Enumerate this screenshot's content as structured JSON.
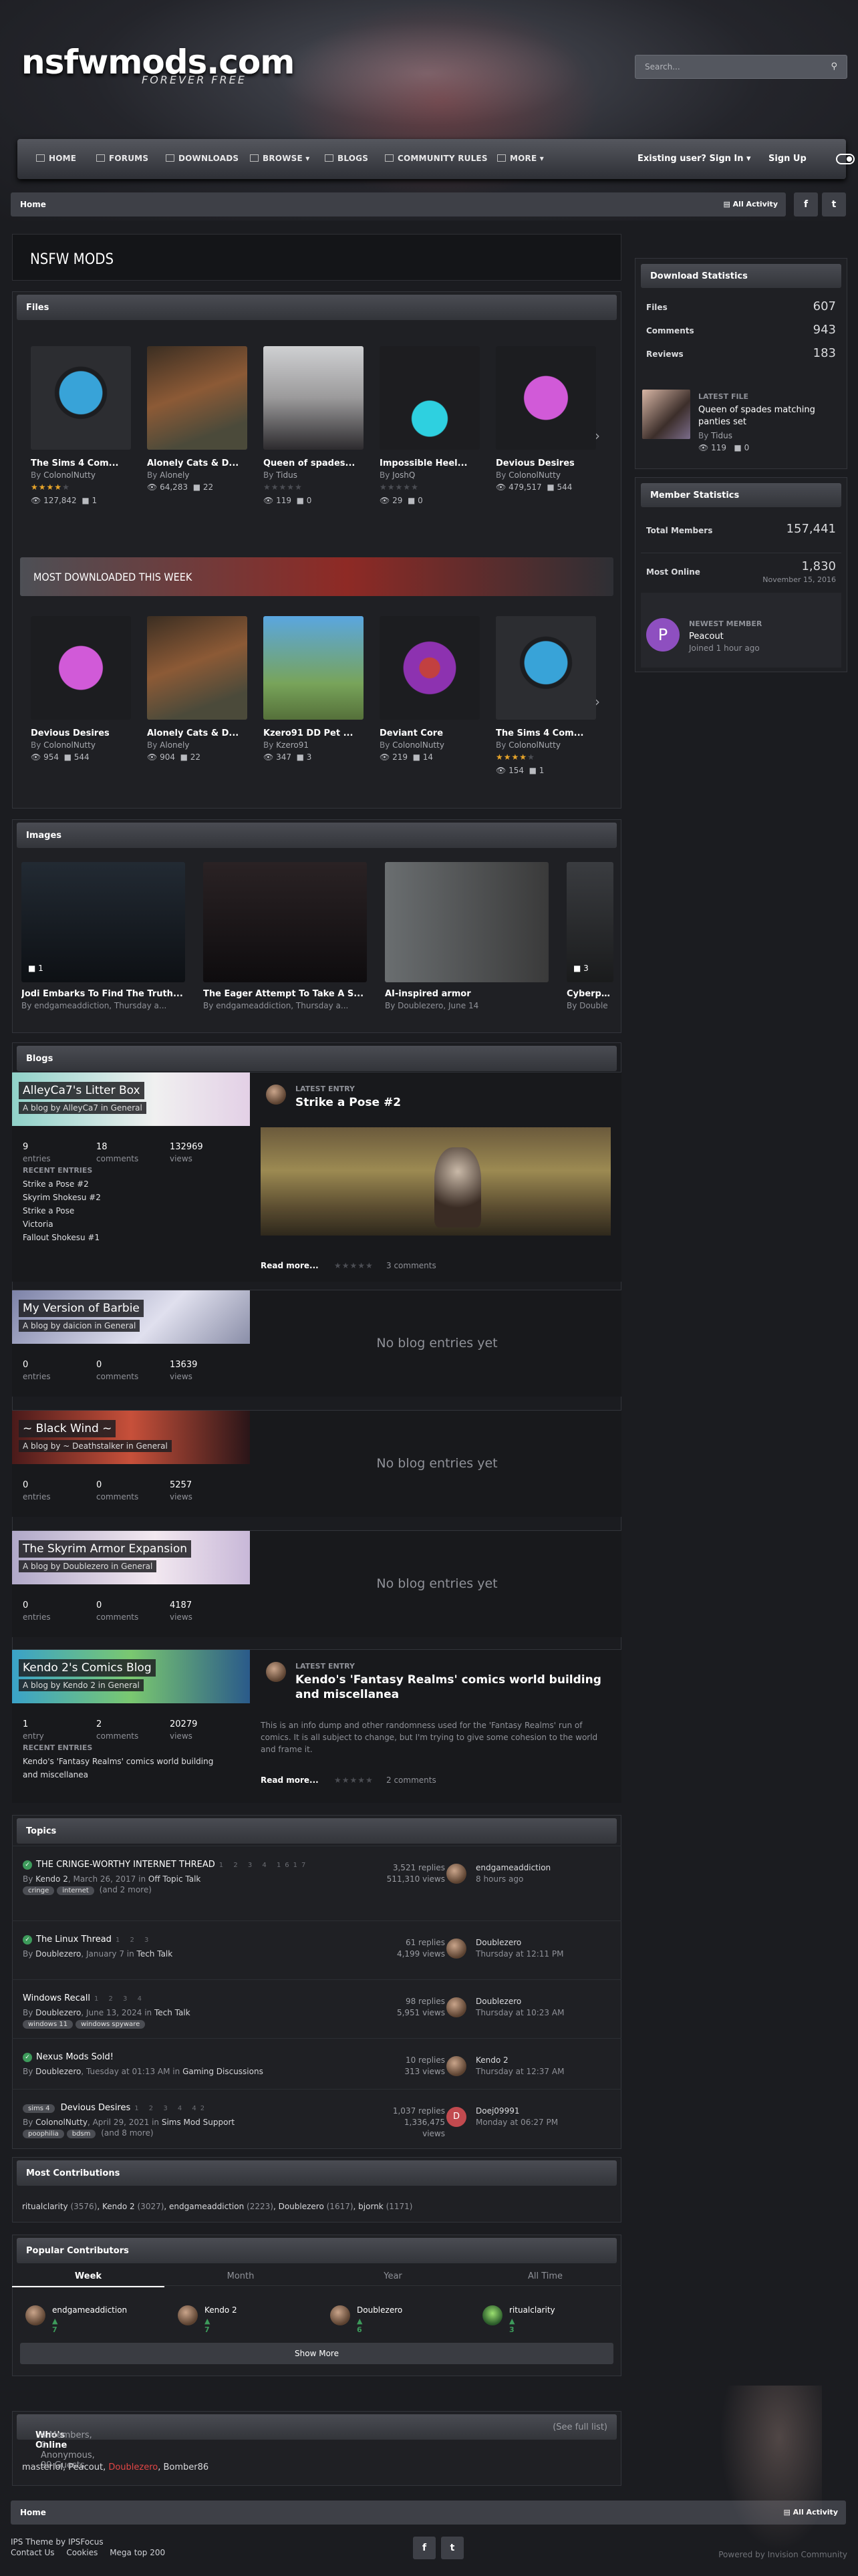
{
  "site": {
    "logo": "nsfwmods.com",
    "tagline": "FOREVER FREE"
  },
  "search": {
    "placeholder": "Search..."
  },
  "nav": {
    "items": [
      "Home",
      "Forums",
      "Downloads",
      "Browse",
      "Blogs",
      "Community Rules",
      "More"
    ],
    "sign_in": "Existing user? Sign In",
    "sign_up": "Sign Up"
  },
  "breadcrumb": {
    "home": "Home",
    "all_activity": "All Activity"
  },
  "page_title": "NSFW MODS",
  "files": {
    "title": "Files",
    "cards": [
      {
        "title": "The Sims 4 Com...",
        "by": "By",
        "author": "ColonolNutty",
        "views": "127,842",
        "comments": "1",
        "rating": 4
      },
      {
        "title": "Alonely Cats & D...",
        "by": "By",
        "author": "Alonely",
        "views": "64,283",
        "comments": "22",
        "rating": -1
      },
      {
        "title": "Queen of spades...",
        "by": "By",
        "author": "Tidus",
        "views": "119",
        "comments": "0",
        "rating": 0
      },
      {
        "title": "Impossible Heel...",
        "by": "By",
        "author": "JoshQ",
        "views": "29",
        "comments": "0",
        "rating": 0
      },
      {
        "title": "Devious Desires",
        "by": "By",
        "author": "ColonolNutty",
        "views": "479,517",
        "comments": "544",
        "rating": -1
      }
    ]
  },
  "most_downloaded": {
    "title": "MOST DOWNLOADED THIS WEEK",
    "cards": [
      {
        "title": "Devious Desires",
        "by": "By",
        "author": "ColonolNutty",
        "views": "954",
        "comments": "544",
        "rating": -1
      },
      {
        "title": "Alonely Cats & D...",
        "by": "By",
        "author": "Alonely",
        "views": "904",
        "comments": "22",
        "rating": -1
      },
      {
        "title": "Kzero91 DD Pet ...",
        "by": "By",
        "author": "Kzero91",
        "views": "347",
        "comments": "3",
        "rating": -1
      },
      {
        "title": "Deviant Core",
        "by": "By",
        "author": "ColonolNutty",
        "views": "219",
        "comments": "14",
        "rating": -1
      },
      {
        "title": "The Sims 4 Com...",
        "by": "By",
        "author": "ColonolNutty",
        "views": "154",
        "comments": "1",
        "rating": 4
      }
    ]
  },
  "images": {
    "title": "Images",
    "cards": [
      {
        "title": "Jodi Embarks To Find The Truth...",
        "meta": "By endgameaddiction, Thursday a...",
        "comments": "1"
      },
      {
        "title": "The Eager Attempt To Take A S...",
        "meta": "By endgameaddiction, Thursday a...",
        "comments": ""
      },
      {
        "title": "AI-inspired armor",
        "meta": "By Doublezero, June 14",
        "comments": ""
      },
      {
        "title": "Cyberpun",
        "meta": "By Double",
        "comments": "3"
      }
    ]
  },
  "blogs": {
    "title": "Blogs",
    "labels": {
      "entries": "entries",
      "entry": "entry",
      "comments": "comments",
      "views": "views",
      "recent": "RECENT ENTRIES",
      "latest": "LATEST ENTRY",
      "read_more": "Read more...",
      "no_entries": "No blog entries yet"
    },
    "items": [
      {
        "name": "AlleyCa7's Litter Box",
        "by": "A blog by AlleyCa7 in General",
        "entries": "9",
        "comments": "18",
        "views": "132969",
        "recent": [
          "Strike a Pose #2",
          "Skyrim Shokesu #2",
          "Strike a Pose",
          "Victoria",
          "Fallout Shokesu #1"
        ],
        "latest_title": "Strike a Pose #2",
        "latest_comments": "3 comments"
      },
      {
        "name": "My Version of Barbie",
        "by": "A blog by daicion in General",
        "entries": "0",
        "comments": "0",
        "views": "13639"
      },
      {
        "name": "~ Black Wind ~",
        "by": "A blog by ~ Deathstalker in General",
        "entries": "0",
        "comments": "0",
        "views": "5257"
      },
      {
        "name": "The Skyrim Armor Expansion",
        "by": "A blog by Doublezero in General",
        "entries": "0",
        "comments": "0",
        "views": "4187"
      },
      {
        "name": "Kendo 2's Comics Blog",
        "by": "A blog by Kendo 2 in General",
        "entries": "1",
        "comments": "2",
        "views": "20279",
        "recent": [
          "Kendo's 'Fantasy Realms' comics world building",
          "and miscellanea"
        ],
        "latest_title": "Kendo's 'Fantasy Realms' comics world building and miscellanea",
        "latest_excerpt": "This is an info dump and other randomness used for the 'Fantasy Realms' run of comics. It is all subject to change, but I'm trying to give some cohesion to the world and frame it.",
        "latest_comments": "2 comments"
      }
    ]
  },
  "topics": {
    "title": "Topics",
    "items": [
      {
        "title": "THE CRINGE-WORTHY INTERNET THREAD",
        "pages": "1 2 3 4 1617",
        "by": "By",
        "author": "Kendo 2",
        "date": ", March 26, 2017 in ",
        "forum": "Off Topic Talk",
        "tags": [
          "cringe",
          "internet"
        ],
        "more": "(and 2 more)",
        "replies": "3,521 replies",
        "views": "511,310 views",
        "last_user": "endgameaddiction",
        "last_time": "8 hours ago",
        "dot": true
      },
      {
        "title": "The Linux Thread",
        "pages": "1 2 3",
        "by": "By",
        "author": "Doublezero",
        "date": ", January 7 in ",
        "forum": "Tech Talk",
        "tags": [],
        "more": "",
        "replies": "61 replies",
        "views": "4,199 views",
        "last_user": "Doublezero",
        "last_time": "Thursday at 12:11 PM",
        "dot": true
      },
      {
        "title": "Windows Recall",
        "pages": "1 2 3 4",
        "by": "By",
        "author": "Doublezero",
        "date": ", June 13, 2024 in ",
        "forum": "Tech Talk",
        "tags": [
          "windows 11",
          "windows spyware"
        ],
        "more": "",
        "replies": "98 replies",
        "views": "5,951 views",
        "last_user": "Doublezero",
        "last_time": "Thursday at 10:23 AM",
        "dot": false
      },
      {
        "title": "Nexus Mods Sold!",
        "pages": "",
        "by": "By",
        "author": "Doublezero",
        "date": ", Tuesday at 01:13 AM in ",
        "forum": "Gaming Discussions",
        "tags": [],
        "more": "",
        "replies": "10 replies",
        "views": "313 views",
        "last_user": "Kendo 2",
        "last_time": "Thursday at 12:37 AM",
        "dot": true
      },
      {
        "title": "Devious Desires",
        "pages": "1 2 3 4 42",
        "prefix": "sims 4",
        "by": "By",
        "author": "ColonolNutty",
        "date": ", April 29, 2021 in ",
        "forum": "Sims Mod Support",
        "tags": [
          "poophilia",
          "bdsm"
        ],
        "more": "(and 8 more)",
        "replies": "1,037 replies",
        "views": "1,336,475 views",
        "last_user": "Doej09991",
        "last_time": "Monday at 06:27 PM",
        "dot": false
      }
    ]
  },
  "contributions": {
    "title": "Most Contributions",
    "people": [
      {
        "name": "ritualclarity",
        "count": "(3576)"
      },
      {
        "name": "Kendo 2",
        "count": "(3027)"
      },
      {
        "name": "endgameaddiction",
        "count": "(2223)"
      },
      {
        "name": "Doublezero",
        "count": "(1617)"
      },
      {
        "name": "bjornk",
        "count": "(1171)"
      }
    ]
  },
  "popular": {
    "title": "Popular Contributors",
    "tabs": [
      "Week",
      "Month",
      "Year",
      "All Time"
    ],
    "people": [
      {
        "name": "endgameaddiction",
        "score": "7"
      },
      {
        "name": "Kendo 2",
        "score": "7"
      },
      {
        "name": "Doublezero",
        "score": "6"
      },
      {
        "name": "ritualclarity",
        "score": "3"
      }
    ],
    "show_more": "Show More"
  },
  "online": {
    "title": "Who's Online",
    "summary": "4 Members, 0 Anonymous, 99 Guests",
    "full_list": "(See full list)",
    "users": [
      "masterlol",
      "Peacout",
      "Doublezero",
      "Bomber86"
    ]
  },
  "sidebar": {
    "downloads": {
      "title": "Download Statistics",
      "rows": [
        {
          "label": "Files",
          "value": "607"
        },
        {
          "label": "Comments",
          "value": "943"
        },
        {
          "label": "Reviews",
          "value": "183"
        }
      ],
      "latest_label": "LATEST FILE",
      "latest_title": "Queen of spades matching panties set",
      "latest_by": "By",
      "latest_author": "Tidus",
      "latest_views": "119",
      "latest_comments": "0"
    },
    "members": {
      "title": "Member Statistics",
      "total_label": "Total Members",
      "total": "157,441",
      "online_label": "Most Online",
      "online": "1,830",
      "online_date": "November 15, 2016",
      "newest_label": "NEWEST MEMBER",
      "newest": "Peacout",
      "joined": "Joined 1 hour ago"
    }
  },
  "footer": {
    "theme": "IPS Theme by IPSFocus",
    "links": [
      "Contact Us",
      "Cookies",
      "Mega top 200"
    ],
    "powered": "Powered by Invision Community"
  },
  "colors": {
    "accent": "#3d9b5b",
    "star": "#e8a52a",
    "avatar_purple": "#8e4fc0",
    "avatar_red": "#c24a4f"
  }
}
